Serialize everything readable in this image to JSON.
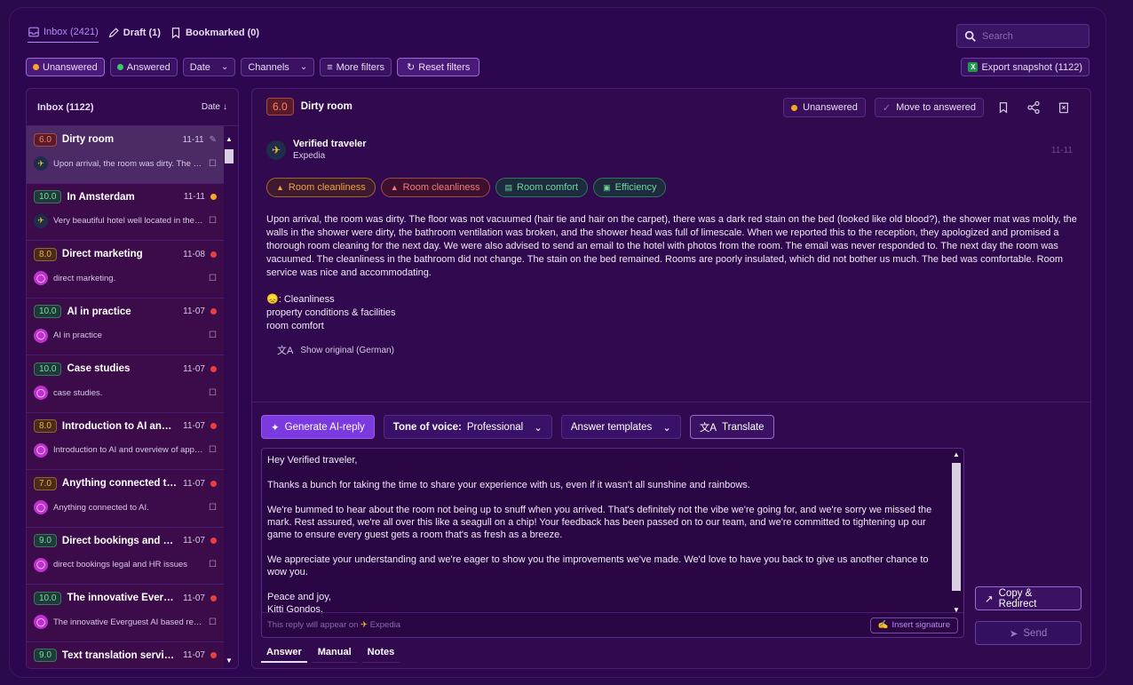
{
  "top_tabs": [
    {
      "label": "Inbox (2421)",
      "icon": "inbox-icon"
    },
    {
      "label": "Draft (1)",
      "icon": "pencil-icon"
    },
    {
      "label": "Bookmarked (0)",
      "icon": "bookmark-icon"
    }
  ],
  "search": {
    "placeholder": "Search"
  },
  "filters": {
    "unanswered": "Unanswered",
    "answered": "Answered",
    "date": "Date",
    "channels": "Channels",
    "more": "More filters",
    "reset": "Reset filters"
  },
  "export_label": "Export snapshot (1122)",
  "list": {
    "title": "Inbox (1122)",
    "sort_label": "Date",
    "items": [
      {
        "score": "6.0",
        "title": "Dirty room",
        "date": "11-11",
        "snippet": "Upon arrival, the room was dirty. The floor was not vacuumed",
        "source": "expedia",
        "status": "pencil"
      },
      {
        "score": "10.0",
        "title": "In Amsterdam",
        "date": "11-11",
        "snippet": "Very beautiful hotel well located in the city center",
        "source": "expedia",
        "status": "orange"
      },
      {
        "score": "8.0",
        "title": "Direct marketing",
        "date": "11-08",
        "snippet": "direct marketing.",
        "source": "message",
        "status": "red"
      },
      {
        "score": "10.0",
        "title": "AI in practice",
        "date": "11-07",
        "snippet": "AI in practice",
        "source": "message",
        "status": "red"
      },
      {
        "score": "10.0",
        "title": "Case studies",
        "date": "11-07",
        "snippet": "case studies.",
        "source": "message",
        "status": "red"
      },
      {
        "score": "8.0",
        "title": "Introduction to AI and overview",
        "date": "11-07",
        "snippet": "Introduction to AI and overview of applications",
        "source": "message",
        "status": "red"
      },
      {
        "score": "7.0",
        "title": "Anything connected to AI",
        "date": "11-07",
        "snippet": "Anything connected to AI.",
        "source": "message",
        "status": "red"
      },
      {
        "score": "9.0",
        "title": "Direct bookings and HR issues",
        "date": "11-07",
        "snippet": "direct bookings legal and HR issues",
        "source": "message",
        "status": "red"
      },
      {
        "score": "10.0",
        "title": "The innovative Everguest AI",
        "date": "11-07",
        "snippet": "The innovative Everguest AI based reply tool",
        "source": "message",
        "status": "red"
      },
      {
        "score": "9.0",
        "title": "Text translation services",
        "date": "11-07",
        "snippet": "Text translation services",
        "source": "message",
        "status": "red"
      }
    ]
  },
  "detail": {
    "score": "6.0",
    "title": "Dirty room",
    "status_label": "Unanswered",
    "move_label": "Move to answered",
    "reviewer": "Verified traveler",
    "platform": "Expedia",
    "date": "11-11",
    "tags": [
      {
        "label": "Room cleanliness",
        "color": "orange",
        "icon": "broom-icon"
      },
      {
        "label": "Room cleanliness",
        "color": "red",
        "icon": "broom-icon"
      },
      {
        "label": "Room comfort",
        "color": "green",
        "icon": "bed-icon"
      },
      {
        "label": "Efficiency",
        "color": "green",
        "icon": "efficiency-icon"
      }
    ],
    "review_text": "Upon arrival, the room was dirty. The floor was not vacuumed (hair tie and hair on the carpet), there was a dark red stain on the bed (looked like old blood?), the shower mat was moldy, the walls in the shower were dirty, the bathroom ventilation was broken, and the shower head was full of limescale. When we reported this to the reception, they apologized and promised a thorough room cleaning for the next day. We were also advised to send an email to the hotel with photos from the room. The email was never responded to. The next day the room was vacuumed. The cleanliness in the bathroom did not change. The stain on the bed remained. Rooms are poorly insulated, which did not bother us much. The bed was comfortable. Room service was nice and accommodating.",
    "category_line1": ": Cleanliness",
    "category_line2": "property conditions & facilities",
    "category_line3": "room comfort",
    "show_original": "Show original (German)"
  },
  "reply": {
    "generate_label": "Generate AI-reply",
    "tone_prefix": "Tone of voice:",
    "tone_value": "Professional",
    "templates_label": "Answer templates",
    "translate_label": "Translate",
    "text": "Hey Verified traveler,\n\nThanks a bunch for taking the time to share your experience with us, even if it wasn't all sunshine and rainbows.\n\nWe're bummed to hear about the room not being up to snuff when you arrived. That's definitely not the vibe we're going for, and we're sorry we missed the mark. Rest assured, we're all over this like a seagull on a chip! Your feedback has been passed on to our team, and we're committed to tightening up our game to ensure every guest gets a room that's as fresh as a breeze.\n\nWe appreciate your understanding and we're eager to show you the improvements we've made. We'd love to have you back to give us another chance to wow you.\n\nPeace and joy,\nKitti Gondos,",
    "footer_note": "This reply will appear on",
    "footer_platform": "Expedia",
    "insert_signature": "Insert signature",
    "copy_redirect": "Copy & Redirect",
    "send": "Send"
  },
  "bottom_tabs": [
    "Answer",
    "Manual",
    "Notes"
  ],
  "colors": {
    "accent": "#7a3ae0",
    "unanswered_dot": "#f5a623",
    "answered_dot": "#3cc870",
    "status_red": "#e84040"
  }
}
